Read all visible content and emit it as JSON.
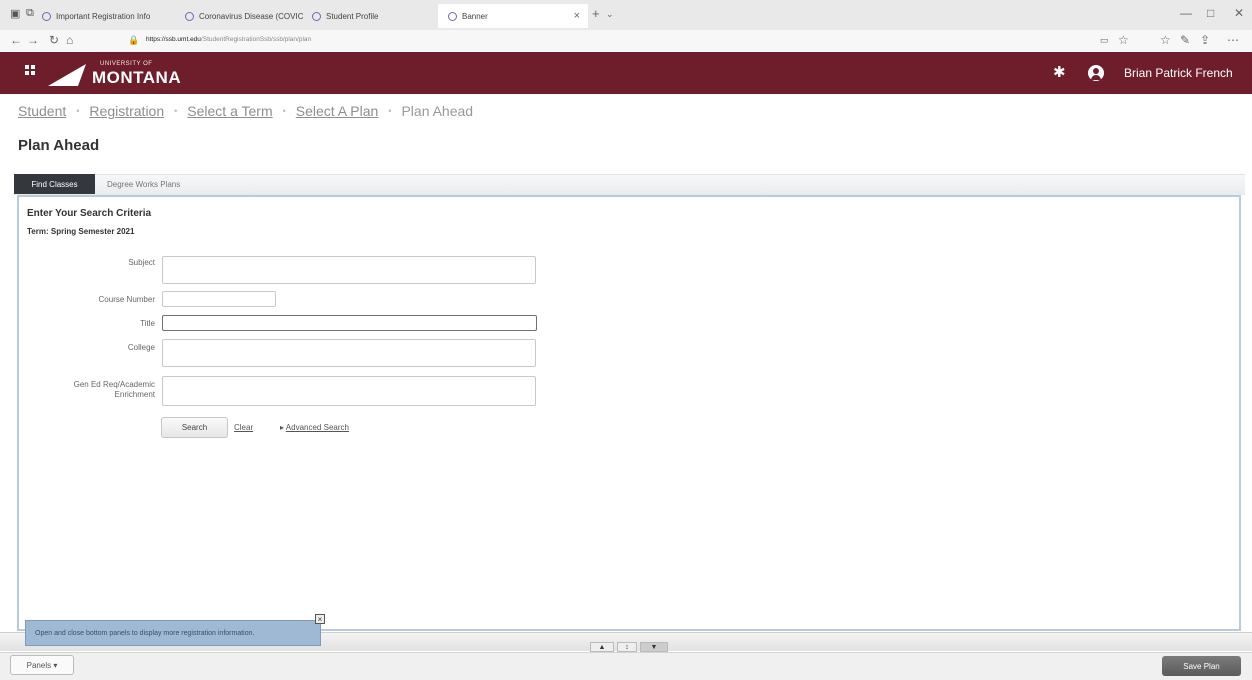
{
  "browser": {
    "tabs": [
      {
        "label": "Important Registration Info"
      },
      {
        "label": "Coronavirus Disease (COVIC"
      },
      {
        "label": "Student Profile"
      },
      {
        "label": "Banner"
      }
    ],
    "url_host": "https://ssb.umt.edu",
    "url_path": "/StudentRegistrationSsb/ssb/plan/plan"
  },
  "header": {
    "logo_small": "UNIVERSITY OF",
    "logo_main": "MONTANA",
    "username": "Brian Patrick French"
  },
  "breadcrumb": [
    "Student",
    "Registration",
    "Select a Term",
    "Select A Plan",
    "Plan Ahead"
  ],
  "page_title": "Plan Ahead",
  "tabs": {
    "find": "Find Classes",
    "degree_works": "Degree Works Plans"
  },
  "search": {
    "title": "Enter Your Search Criteria",
    "term": "Term: Spring Semester 2021",
    "fields": {
      "subject": "Subject",
      "course_number": "Course Number",
      "title": "Title",
      "college": "College",
      "gen_ed_1": "Gen Ed Req/Academic",
      "gen_ed_2": "Enrichment"
    },
    "search_button": "Search",
    "clear": "Clear",
    "advanced": "Advanced Search"
  },
  "tip": "Open and close bottom panels to display more registration information.",
  "footer": {
    "panels": "Panels",
    "save_plan": "Save Plan"
  }
}
